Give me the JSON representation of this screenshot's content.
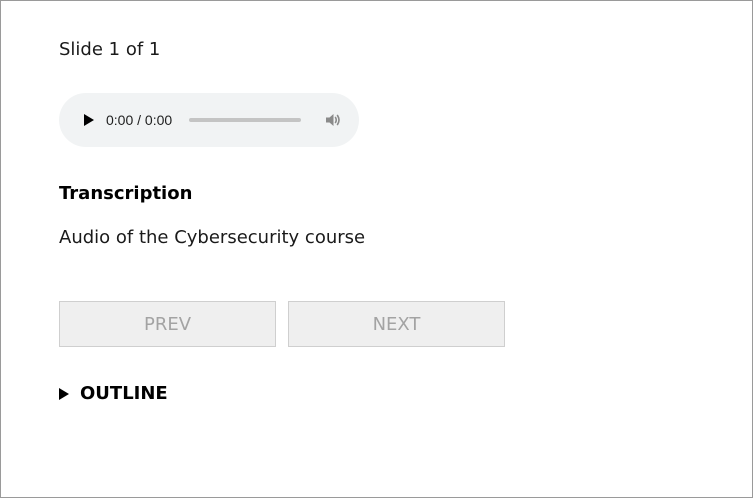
{
  "slide_counter": "Slide 1 of 1",
  "audio": {
    "time": "0:00 / 0:00",
    "progress": 0,
    "icons": {
      "play": "play-icon",
      "volume": "volume-icon"
    }
  },
  "transcription": {
    "heading": "Transcription",
    "text": "Audio of the Cybersecurity course"
  },
  "navigation": {
    "prev_label": "PREV",
    "next_label": "NEXT"
  },
  "outline": {
    "label": "OUTLINE",
    "expanded": false
  },
  "colors": {
    "player_bg": "#f1f3f4",
    "button_bg": "#efefef",
    "button_text_disabled": "#a3a3a3",
    "frame_border": "#9a9a9a"
  }
}
